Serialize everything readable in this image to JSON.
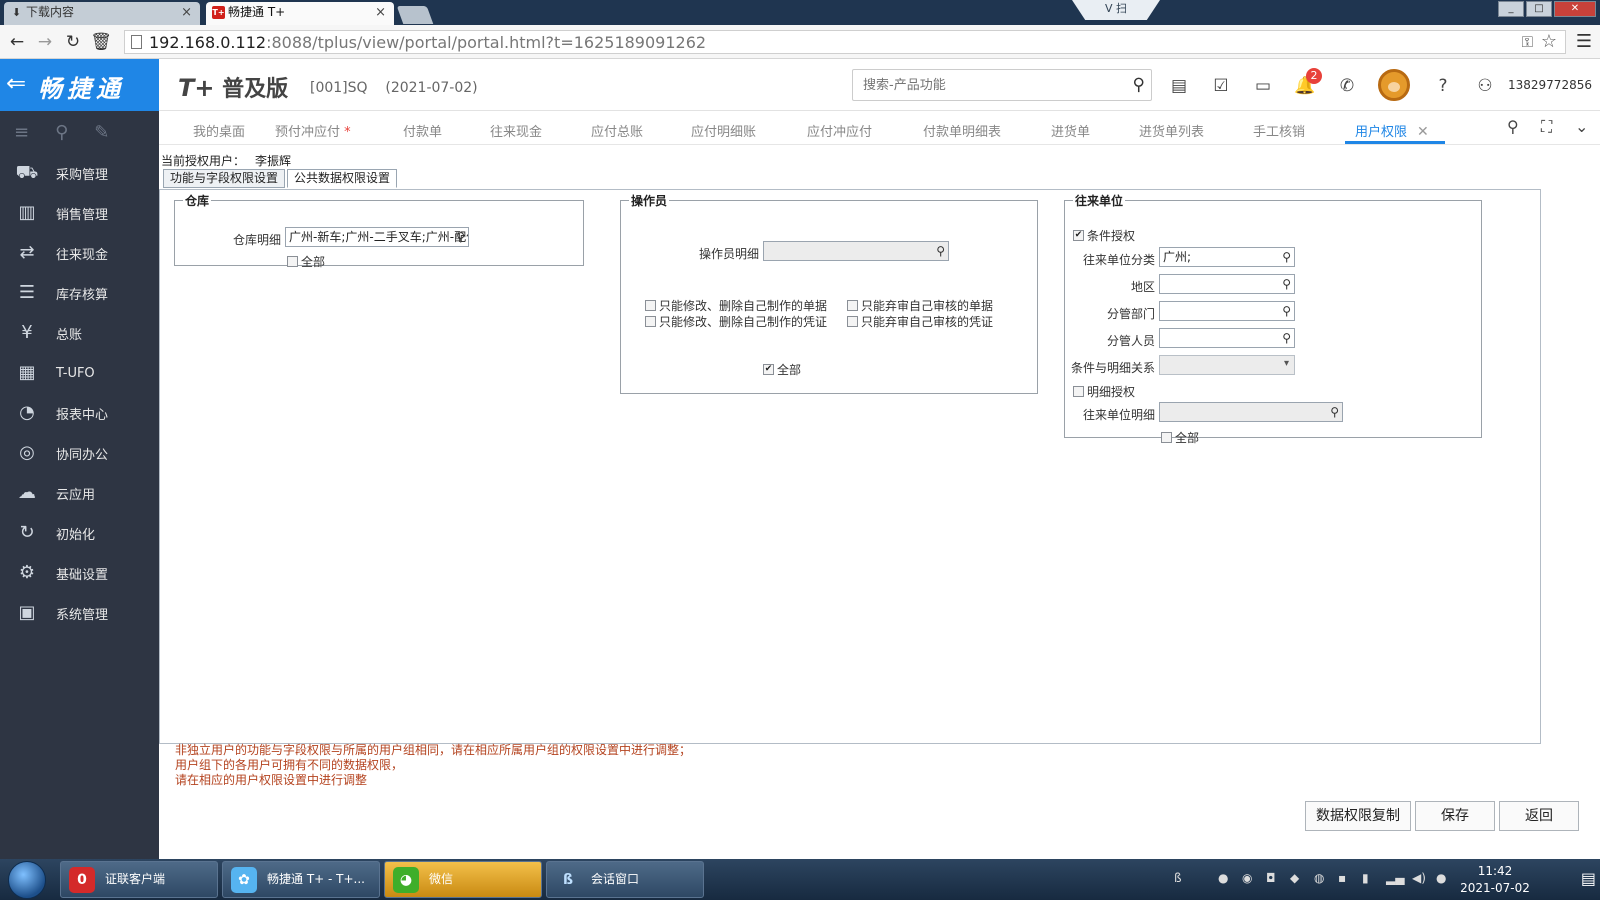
{
  "browser": {
    "tabs": [
      {
        "label": "下载内容",
        "icon": "download-icon",
        "active": false
      },
      {
        "label": "畅捷通 T+",
        "icon": "tplus-favicon",
        "active": true
      }
    ],
    "tab_favicon_text": "T+",
    "vtag": "V 扫",
    "url_host": "192.168.0.112",
    "url_rest": ":8088/tplus/view/portal/portal.html?t=1625189091262"
  },
  "app": {
    "logo": "畅捷通",
    "edition_tp": "T+",
    "edition": "普及版",
    "account": "[001]SQ    (2021-07-02)",
    "search_placeholder": "搜索-产品功能",
    "notifications": "2",
    "user_phone": "13829772856"
  },
  "sidebar": {
    "items": [
      {
        "label": "采购管理",
        "icon": "purchase-icon"
      },
      {
        "label": "销售管理",
        "icon": "sales-chart-icon"
      },
      {
        "label": "往来现金",
        "icon": "exchange-icon"
      },
      {
        "label": "库存核算",
        "icon": "inventory-icon"
      },
      {
        "label": "总账",
        "icon": "ledger-icon"
      },
      {
        "label": "T-UFO",
        "icon": "ufo-report-icon"
      },
      {
        "label": "报表中心",
        "icon": "pie-chart-icon"
      },
      {
        "label": "协同办公",
        "icon": "collaboration-icon"
      },
      {
        "label": "云应用",
        "icon": "cloud-icon"
      },
      {
        "label": "初始化",
        "icon": "refresh-icon"
      },
      {
        "label": "基础设置",
        "icon": "settings-icon"
      },
      {
        "label": "系统管理",
        "icon": "monitor-icon"
      }
    ]
  },
  "module_tabs": [
    "我的桌面",
    "预付冲应付",
    "付款单",
    "往来现金",
    "应付总账",
    "应付明细账",
    "应付冲应付",
    "付款单明细表",
    "进货单",
    "进货单列表",
    "手工核销",
    "用户权限"
  ],
  "modified_marker": "*",
  "content": {
    "current_user_label": "当前授权用户：",
    "current_user": "李振辉",
    "subtabs": [
      "功能与字段权限设置",
      "公共数据权限设置"
    ],
    "warehouse": {
      "title": "仓库",
      "detail_label": "仓库明细",
      "detail_value": "广州-新车;广州-二手叉车;广州-配件",
      "all_label": "全部"
    },
    "operator": {
      "title": "操作员",
      "detail_label": "操作员明细",
      "detail_value": "",
      "options": [
        "只能修改、删除自己制作的单据",
        "只能弃审自己审核的单据",
        "只能修改、删除自己制作的凭证",
        "只能弃审自己审核的凭证"
      ],
      "all_label": "全部"
    },
    "partner": {
      "title": "往来单位",
      "cond_auth_label": "条件授权",
      "category_label": "往来单位分类",
      "category_value": "广州;",
      "region_label": "地区",
      "dept_label": "分管部门",
      "person_label": "分管人员",
      "relation_label": "条件与明细关系",
      "detail_auth_label": "明细授权",
      "detail_label": "往来单位明细",
      "all_label": "全部"
    },
    "notes": [
      "非独立用户的功能与字段权限与所属的用户组相同，请在相应所属用户组的权限设置中进行调整；",
      "用户组下的各用户可拥有不同的数据权限，",
      "请在相应的用户权限设置中进行调整"
    ],
    "buttons": {
      "copy": "数据权限复制",
      "save": "保存",
      "back": "返回"
    }
  },
  "taskbar": {
    "items": [
      {
        "label": "证联客户端",
        "icon": "zhenglian-icon"
      },
      {
        "label": "畅捷通 T+ - T+...",
        "icon": "tplus-taskbar-icon"
      },
      {
        "label": "微信",
        "icon": "wechat-icon"
      },
      {
        "label": "会话窗口",
        "icon": "chat-session-icon"
      }
    ],
    "time": "11:42",
    "date": "2021-07-02"
  }
}
